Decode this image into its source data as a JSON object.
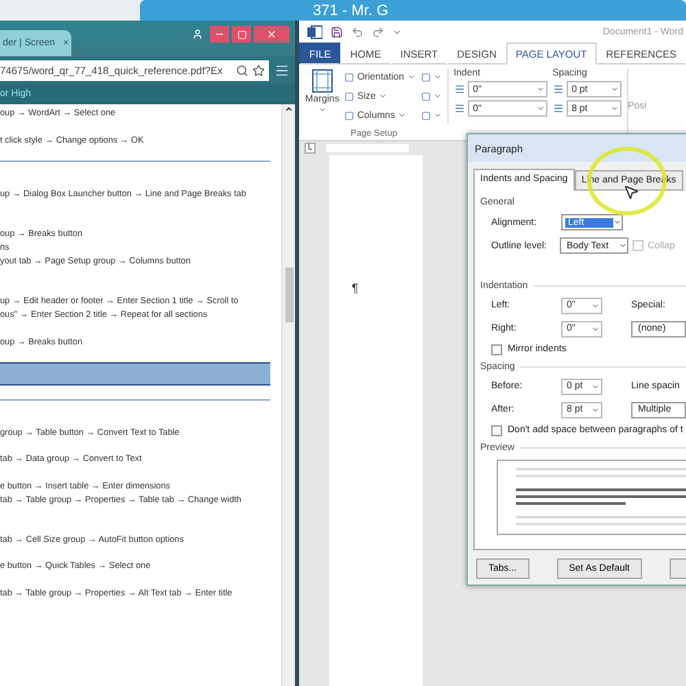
{
  "banner": {
    "title": "371 - Mr. G"
  },
  "browser": {
    "tab": {
      "title": "der | Screen",
      "close": "×"
    },
    "address": "74675/word_qr_77_418_quick_reference.pdf?Ex",
    "bookmark": "or High",
    "lines": [
      {
        "kind": "text",
        "text": "oup → WordArt → Select one"
      },
      {
        "kind": "space"
      },
      {
        "kind": "text",
        "text": "t click style → Change options → OK"
      },
      {
        "kind": "space"
      },
      {
        "kind": "rule"
      },
      {
        "kind": "space"
      },
      {
        "kind": "space"
      },
      {
        "kind": "text",
        "text": "up → Dialog Box Launcher button → Line and Page Breaks tab"
      },
      {
        "kind": "space"
      },
      {
        "kind": "space"
      },
      {
        "kind": "text",
        "text": "oup → Breaks button"
      },
      {
        "kind": "text",
        "text": "ns"
      },
      {
        "kind": "text",
        "text": "yout tab → Page Setup group → Columns button"
      },
      {
        "kind": "space"
      },
      {
        "kind": "space"
      },
      {
        "kind": "text",
        "text": "up → Edit header or footer → Enter Section 1 title → Scroll to"
      },
      {
        "kind": "text",
        "text": "ous\" → Enter Section 2 title → Repeat for all sections"
      },
      {
        "kind": "space"
      },
      {
        "kind": "text",
        "text": "oup → Breaks button"
      },
      {
        "kind": "space"
      },
      {
        "kind": "highlight"
      },
      {
        "kind": "space"
      },
      {
        "kind": "rule"
      },
      {
        "kind": "space"
      },
      {
        "kind": "space"
      },
      {
        "kind": "text",
        "text": "group → Table button → Convert Text to Table"
      },
      {
        "kind": "space"
      },
      {
        "kind": "text",
        "text": "tab → Data group → Convert to Text"
      },
      {
        "kind": "space"
      },
      {
        "kind": "text",
        "text": "e button → Insert table → Enter dimensions"
      },
      {
        "kind": "text",
        "text": "tab → Table group → Properties → Table tab → Change width"
      },
      {
        "kind": "space"
      },
      {
        "kind": "space"
      },
      {
        "kind": "text",
        "text": "tab → Cell Size group → AutoFit button options"
      },
      {
        "kind": "space"
      },
      {
        "kind": "text",
        "text": "e button → Quick Tables → Select one"
      },
      {
        "kind": "space"
      },
      {
        "kind": "text",
        "text": "tab → Table group → Properties → Alt Text tab → Enter title"
      }
    ]
  },
  "word": {
    "doc_title": "Document1 - Word",
    "tabs": [
      {
        "label": "FILE",
        "kind": "file",
        "selected": false
      },
      {
        "label": "HOME",
        "kind": "tab",
        "selected": false
      },
      {
        "label": "INSERT",
        "kind": "tab",
        "selected": false
      },
      {
        "label": "DESIGN",
        "kind": "tab",
        "selected": false
      },
      {
        "label": "PAGE LAYOUT",
        "kind": "tab",
        "selected": true
      },
      {
        "label": "REFERENCES",
        "kind": "tab",
        "selected": false
      }
    ],
    "ribbon": {
      "margins": "Margins",
      "setup_items": [
        "Orientation",
        "Size",
        "Columns"
      ],
      "setup_label": "Page Setup",
      "indent_label": "Indent",
      "indent_values": [
        "0\"",
        "0\""
      ],
      "spacing_label": "Spacing",
      "spacing_values": [
        "0 pt",
        "8 pt"
      ],
      "next_group": "Posi"
    },
    "ruler_tab": "L",
    "paragraph_mark": "¶",
    "dialog": {
      "title": "Paragraph",
      "tabs": [
        {
          "label": "Indents and Spacing",
          "selected": true
        },
        {
          "label": "Line and Page Breaks",
          "selected": false
        }
      ],
      "general_label": "General",
      "alignment_label": "Alignment:",
      "alignment": "Left",
      "outline_label": "Outline level:",
      "outline": "Body Text",
      "collapsed": {
        "label": "Collap",
        "checked": false,
        "disabled": true
      },
      "indentation_label": "Indentation",
      "left_label": "Left:",
      "left": "0\"",
      "right_label": "Right:",
      "right": "0\"",
      "special_label": "Special:",
      "special": "(none)",
      "mirror": {
        "label": "Mirror indents",
        "checked": false
      },
      "spacing_label": "Spacing",
      "before_label": "Before:",
      "before": "0 pt",
      "after_label": "After:",
      "after": "8 pt",
      "line_spacing_label": "Line spacin",
      "line_spacing": "Multiple",
      "dont_add": {
        "label": "Don't add space between paragraphs of t",
        "checked": false
      },
      "preview_label": "Preview",
      "buttons": [
        "Tabs...",
        "Set As Default"
      ]
    }
  }
}
